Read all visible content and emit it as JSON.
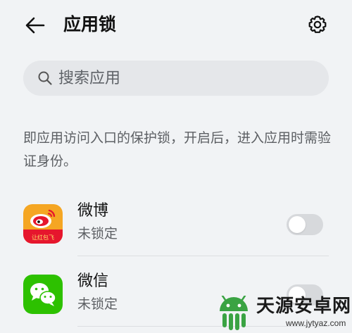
{
  "header": {
    "title": "应用锁",
    "back_icon": "arrow-left-icon",
    "settings_icon": "gear-icon"
  },
  "search": {
    "placeholder": "搜索应用",
    "icon": "search-icon"
  },
  "description": "即应用访问入口的保护锁，开启后，进入应用时需验证身份。",
  "apps": [
    {
      "name": "微博",
      "status": "未锁定",
      "icon": "weibo-icon",
      "icon_caption": "让红包飞",
      "locked": false
    },
    {
      "name": "微信",
      "status": "未锁定",
      "icon": "wechat-icon",
      "locked": false
    }
  ],
  "watermark": {
    "text": "天源安卓网",
    "url": "www.jytyaz.com",
    "icon": "android-logo-icon"
  },
  "colors": {
    "background": "#f1f3f5",
    "search_bg": "#e5e7ea",
    "toggle_off": "#d7d9dc",
    "weibo_orange": "#f5a623",
    "weibo_red": "#e6162d",
    "wechat_green": "#2dc100",
    "watermark_green": "#3aa343"
  }
}
